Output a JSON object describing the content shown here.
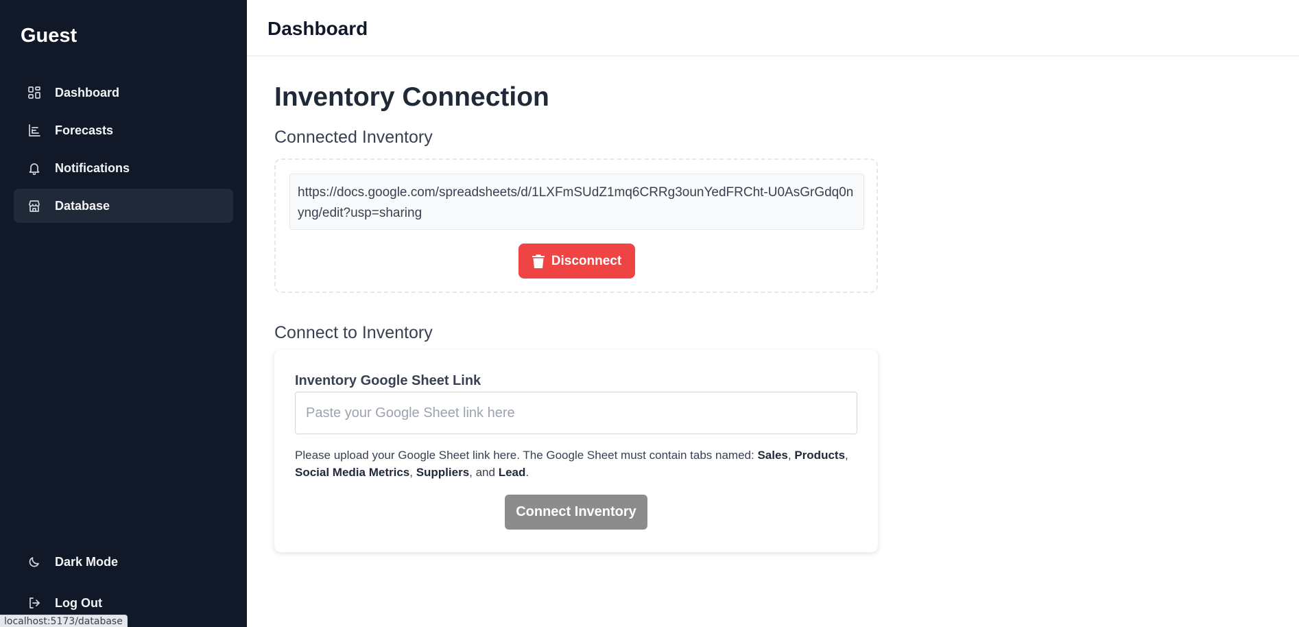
{
  "sidebar": {
    "brand": "Guest",
    "items": [
      {
        "label": "Dashboard",
        "icon": "dashboard-grid-icon"
      },
      {
        "label": "Forecasts",
        "icon": "chart-icon"
      },
      {
        "label": "Notifications",
        "icon": "bell-icon"
      },
      {
        "label": "Database",
        "icon": "store-icon",
        "active": true
      }
    ],
    "bottom_items": [
      {
        "label": "Dark Mode",
        "icon": "moon-icon"
      },
      {
        "label": "Log Out",
        "icon": "logout-icon"
      }
    ]
  },
  "status_url": "localhost:5173/database",
  "header": {
    "title": "Dashboard"
  },
  "main": {
    "page_title": "Inventory Connection",
    "connected": {
      "title": "Connected Inventory",
      "url": "https://docs.google.com/spreadsheets/d/1LXFmSUdZ1mq6CRRg3ounYedFRCht-U0AsGrGdq0nyng/edit?usp=sharing",
      "disconnect_label": "Disconnect"
    },
    "connect": {
      "title": "Connect to Inventory",
      "field_label": "Inventory Google Sheet Link",
      "placeholder": "Paste your Google Sheet link here",
      "value": "",
      "help_prefix": "Please upload your Google Sheet link here. The Google Sheet must contain tabs named: ",
      "tabs": [
        "Sales",
        "Products",
        "Social Media Metrics",
        "Suppliers",
        "Lead"
      ],
      "sep_comma": ", ",
      "sep_and": ", and ",
      "help_suffix": ".",
      "button_label": "Connect Inventory"
    }
  },
  "colors": {
    "sidebar_bg": "#111827",
    "active_item_bg": "#1f2937",
    "disconnect": "#ef4444",
    "connect_disabled": "#8c8c8c"
  }
}
